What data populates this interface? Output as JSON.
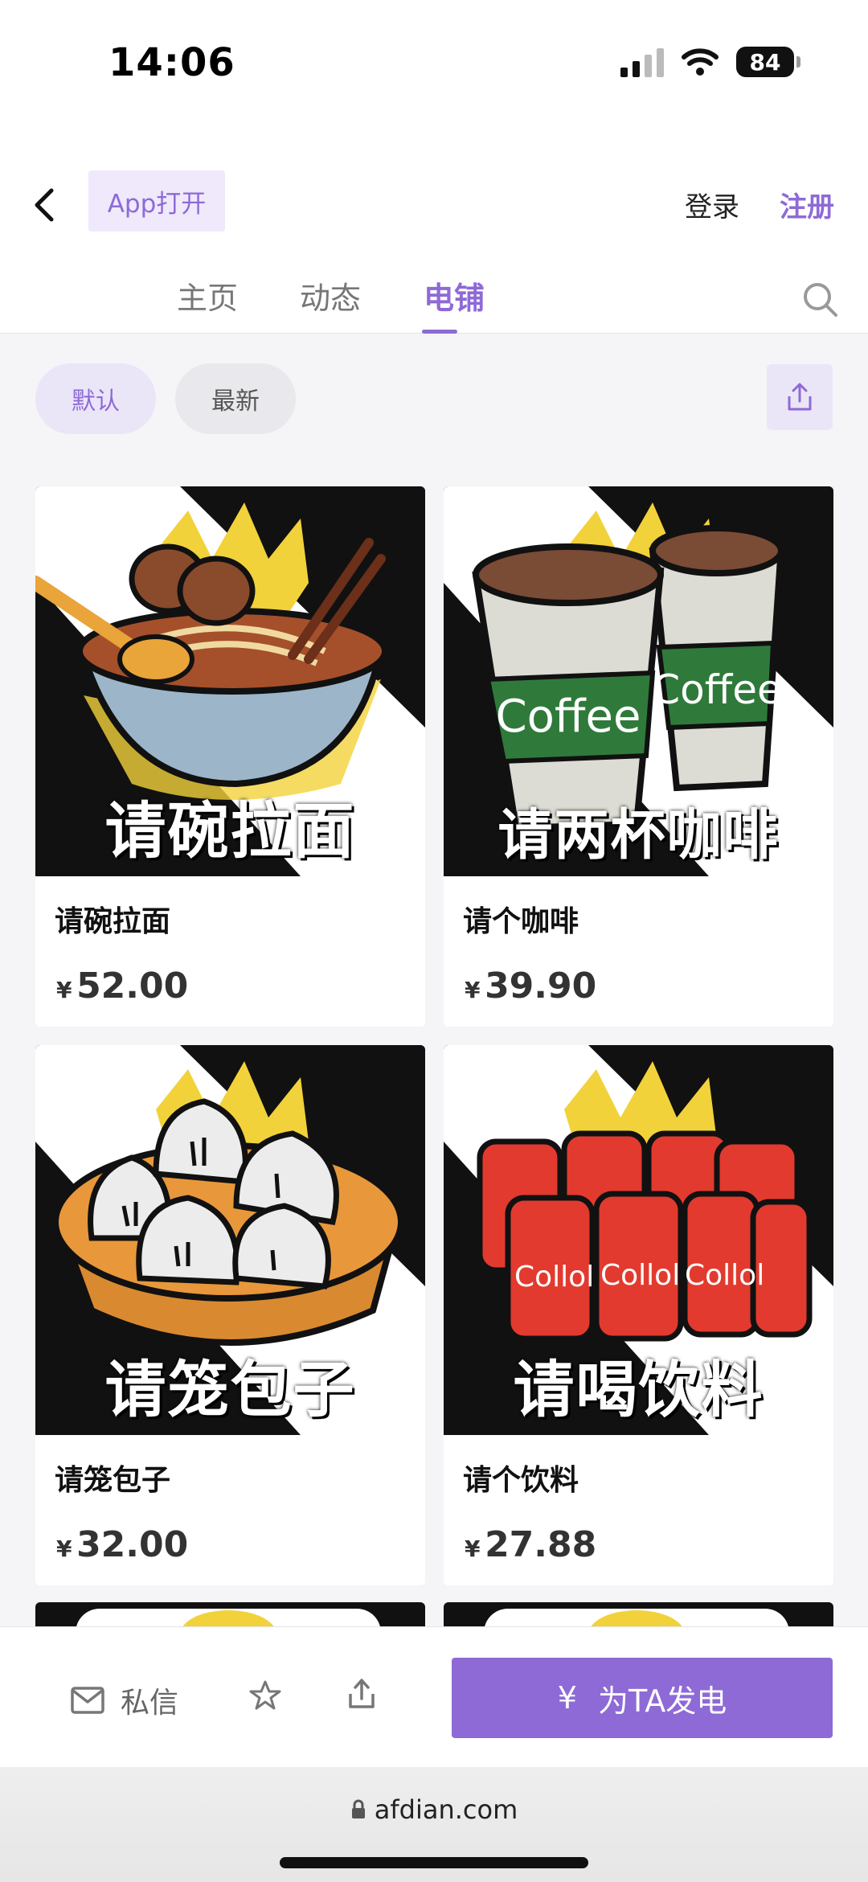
{
  "status": {
    "time": "14:06",
    "battery": "84"
  },
  "header": {
    "app_open": "App打开",
    "login": "登录",
    "register": "注册",
    "tabs": [
      {
        "label": "主页"
      },
      {
        "label": "动态"
      },
      {
        "label": "电铺"
      }
    ]
  },
  "filters": {
    "default": "默认",
    "latest": "最新"
  },
  "products": [
    {
      "title": "请碗拉面",
      "caption": "请碗拉面",
      "currency": "¥",
      "price": "52.00"
    },
    {
      "title": "请个咖啡",
      "caption": "请两杯咖啡",
      "currency": "¥",
      "price": "39.90"
    },
    {
      "title": "请笼包子",
      "caption": "请笼包子",
      "currency": "¥",
      "price": "32.00"
    },
    {
      "title": "请个饮料",
      "caption": "请喝饮料",
      "currency": "¥",
      "price": "27.88"
    }
  ],
  "product_image_text": {
    "coffee": "Coffee",
    "cola": "Collol"
  },
  "bottom": {
    "message": "私信",
    "donate_icon": "¥",
    "donate": "为TA发电"
  },
  "browser": {
    "url": "afdian.com"
  },
  "icons": [
    "back-arrow-icon",
    "search-icon",
    "share-icon",
    "mail-icon",
    "star-icon",
    "lock-icon"
  ],
  "colors": {
    "accent": "#8e6ad6",
    "accent_light": "#ebe5f8"
  }
}
